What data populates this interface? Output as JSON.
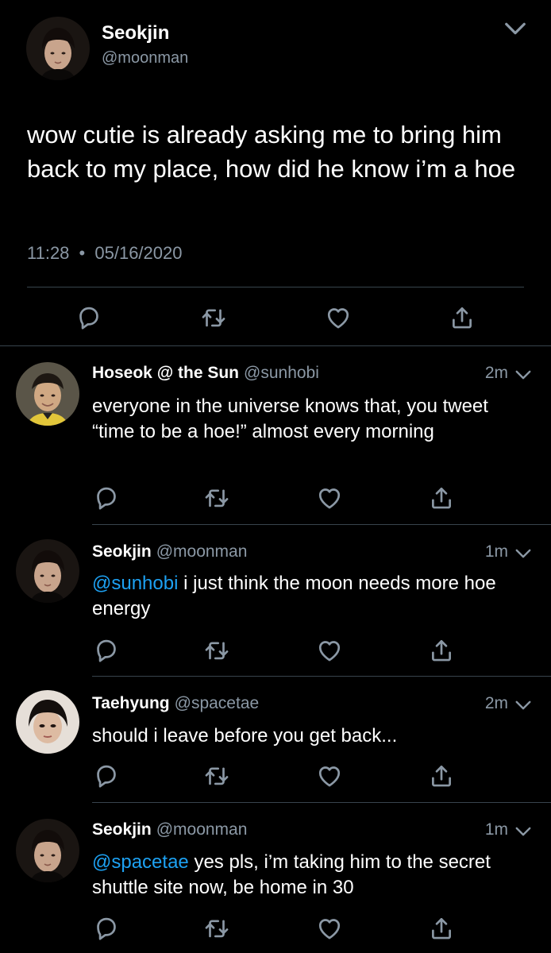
{
  "main_tweet": {
    "author_name": "Seokjin",
    "handle": "@moonman",
    "text": "wow cutie is already asking me to bring him back to my place, how did he know i’m a hoe",
    "time": "11:28",
    "separator": "•",
    "date": "05/16/2020"
  },
  "replies": [
    {
      "author_name": "Hoseok @ the Sun",
      "handle": "@sunhobi",
      "time": "2m",
      "mention": "",
      "text": "everyone in the universe knows that, you tweet “time to be a hoe!” almost every morning"
    },
    {
      "author_name": "Seokjin",
      "handle": "@moonman",
      "time": "1m",
      "mention": "@sunhobi",
      "text": "i just think the moon needs more hoe energy"
    },
    {
      "author_name": "Taehyung",
      "handle": "@spacetae",
      "time": "2m",
      "mention": "",
      "text": "should i leave before you get back..."
    },
    {
      "author_name": "Seokjin",
      "handle": "@moonman",
      "time": "1m",
      "mention": "@spacetae",
      "text": "yes pls, i’m taking him to the secret shuttle site now, be home in 30"
    }
  ],
  "icons": {
    "reply": "reply-icon",
    "retweet": "retweet-icon",
    "like": "heart-icon",
    "share": "share-icon",
    "menu": "chevron-down-icon"
  },
  "colors": {
    "background": "#000000",
    "text": "#ffffff",
    "secondary": "#8b98a5",
    "mention": "#1da1f2",
    "divider": "#38444d"
  }
}
